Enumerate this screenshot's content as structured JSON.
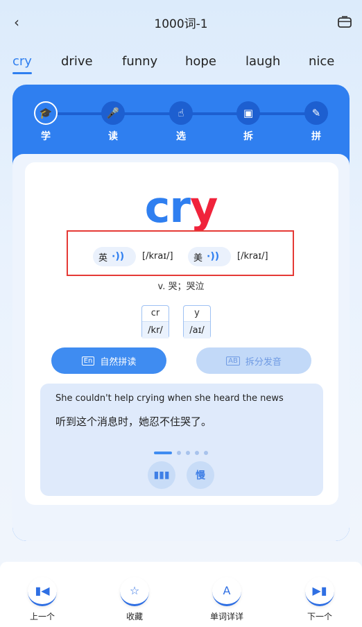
{
  "header": {
    "title": "1000词-1"
  },
  "tabs": [
    "cry",
    "drive",
    "funny",
    "hope",
    "laugh",
    "nice"
  ],
  "steps": [
    {
      "label": "学",
      "icon": "graduation-cap-icon"
    },
    {
      "label": "读",
      "icon": "microphone-icon"
    },
    {
      "label": "选",
      "icon": "pointer-icon"
    },
    {
      "label": "拆",
      "icon": "layers-icon"
    },
    {
      "label": "拼",
      "icon": "pencil-icon"
    }
  ],
  "word": {
    "part1": "cr",
    "part2": "y"
  },
  "pronunciations": [
    {
      "lang": "英",
      "ipa": "[/kraɪ/]"
    },
    {
      "lang": "美",
      "ipa": "[/kraɪ/]"
    }
  ],
  "meaning": "v. 哭；哭泣",
  "chunks": [
    {
      "letters": "cr",
      "sound": "/kr/"
    },
    {
      "letters": "y",
      "sound": "/aɪ/"
    }
  ],
  "buttons": {
    "natural": {
      "icon_text": "En",
      "label": "自然拼读"
    },
    "split": {
      "icon_text": "AB",
      "label": "拆分发音"
    }
  },
  "example": {
    "en": "She couldn't help crying when she heard the news",
    "cn": "听到这个消息时，她忍不住哭了。",
    "slow_label": "慢"
  },
  "bottom_nav": [
    {
      "label": "上一个",
      "icon": "prev-icon"
    },
    {
      "label": "收藏",
      "icon": "star-icon"
    },
    {
      "label": "单词详详",
      "icon": "word-detail-icon"
    },
    {
      "label": "下一个",
      "icon": "next-icon"
    }
  ],
  "colors": {
    "accent": "#2f7ff0",
    "highlight": "#f0233b"
  }
}
